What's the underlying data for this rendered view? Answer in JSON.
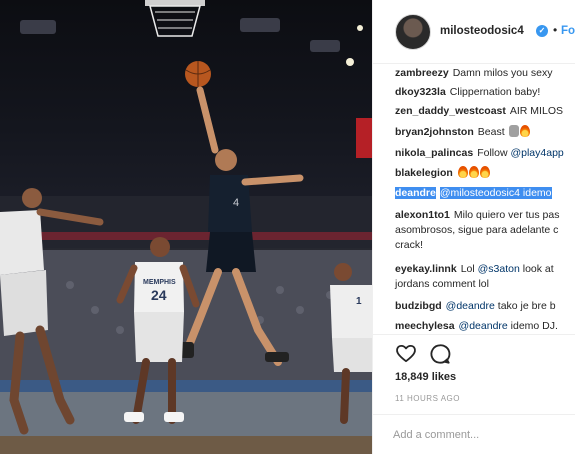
{
  "post": {
    "image_alt_icon": "basketball-photo",
    "jersey_numbers": [
      "4",
      "24",
      "1"
    ],
    "jersey_text": "MEMPHIS"
  },
  "header": {
    "username": "milosteodosic4",
    "verified_icon": "verified-badge-icon",
    "separator": "•",
    "follow_label": "Follo"
  },
  "comments": [
    {
      "user": "zambreezy",
      "text": "Damn milos you sexy"
    },
    {
      "user": "dkoy323la",
      "text": "Clippernation baby!"
    },
    {
      "user": "zen_daddy_westcoast",
      "text": "AIR MILOS"
    },
    {
      "user": "bryan2johnston",
      "text": "Beast",
      "emojis": [
        "wolf",
        "flame"
      ]
    },
    {
      "user": "nikola_palincas",
      "text": "Follow",
      "mention": "@play4app"
    },
    {
      "user": "blakelegion",
      "text": "",
      "emojis": [
        "flame",
        "flame",
        "flame"
      ]
    },
    {
      "user": "deandre",
      "mention": "@milosteodosic4",
      "text": "idemo",
      "highlighted": true
    },
    {
      "user": "alexon1to1",
      "text": "Milo quiero ver tus pas",
      "text2": "asombrosos, sigue para adelante c",
      "text3": "crack!"
    },
    {
      "user": "eyekay.linnk",
      "text": "Lol",
      "mention": "@s3aton",
      "text_after": "look at",
      "text2": "jordans comment lol"
    },
    {
      "user": "budzibgd",
      "mention": "@deandre",
      "text": "tako je bre b"
    },
    {
      "user": "meechylesa",
      "mention": "@deandre",
      "text": "idemo DJ."
    }
  ],
  "actions": {
    "like_icon": "heart-icon",
    "comment_icon": "comment-icon",
    "likes": "18,849 likes",
    "timestamp": "11 HOURS AGO"
  },
  "add_comment": {
    "placeholder": "Add a comment..."
  },
  "colors": {
    "link": "#003569",
    "follow": "#3897f0",
    "selection": "#3f8ef0",
    "muted": "#999999"
  }
}
